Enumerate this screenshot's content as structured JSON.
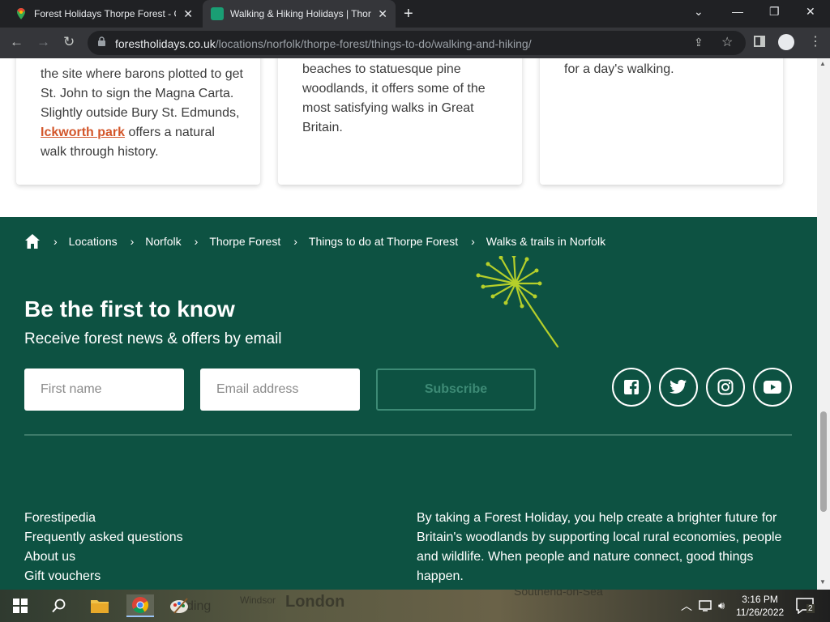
{
  "browser": {
    "tabs": [
      {
        "title": "Forest Holidays Thorpe Forest - G",
        "active": false
      },
      {
        "title": "Walking & Hiking Holidays | Thor",
        "active": true
      }
    ],
    "url_host": "forestholidays.co.uk",
    "url_path": "/locations/norfolk/thorpe-forest/things-to-do/walking-and-hiking/"
  },
  "cards": [
    {
      "text_before": "the site where barons plotted to get St. John to sign the Magna Carta. Slightly outside Bury St. Edmunds, ",
      "link": "Ickworth park",
      "text_after": " offers a natural walk through history."
    },
    {
      "text": "beaches to statuesque pine woodlands, it offers some of the most satisfying walks in Great Britain."
    },
    {
      "text": "for a day's walking."
    }
  ],
  "breadcrumb": [
    "Locations",
    "Norfolk",
    "Thorpe Forest",
    "Things to do at Thorpe Forest",
    "Walks & trails in Norfolk"
  ],
  "newsletter": {
    "title": "Be the first to know",
    "subtitle": "Receive forest news & offers by email",
    "first_name_placeholder": "First name",
    "email_placeholder": "Email address",
    "subscribe_label": "Subscribe"
  },
  "social": [
    "facebook-icon",
    "twitter-icon",
    "instagram-icon",
    "youtube-icon"
  ],
  "footer_links": [
    "Forestipedia",
    "Frequently asked questions",
    "About us",
    "Gift vouchers"
  ],
  "footer_blurb": "By taking a Forest Holiday, you help create a brighter future for Britain's woodlands by supporting local rural economies, people and wildlife. When people and nature connect, good things happen.",
  "taskbar": {
    "time": "3:16 PM",
    "date": "11/26/2022",
    "notifications": "2",
    "wallpaper_labels": [
      "Windsor",
      "London",
      "Southend-on-Sea"
    ]
  },
  "colors": {
    "footer_bg": "#0d5242",
    "accent_link": "#d3562a",
    "dandelion": "#b5cf2a"
  }
}
